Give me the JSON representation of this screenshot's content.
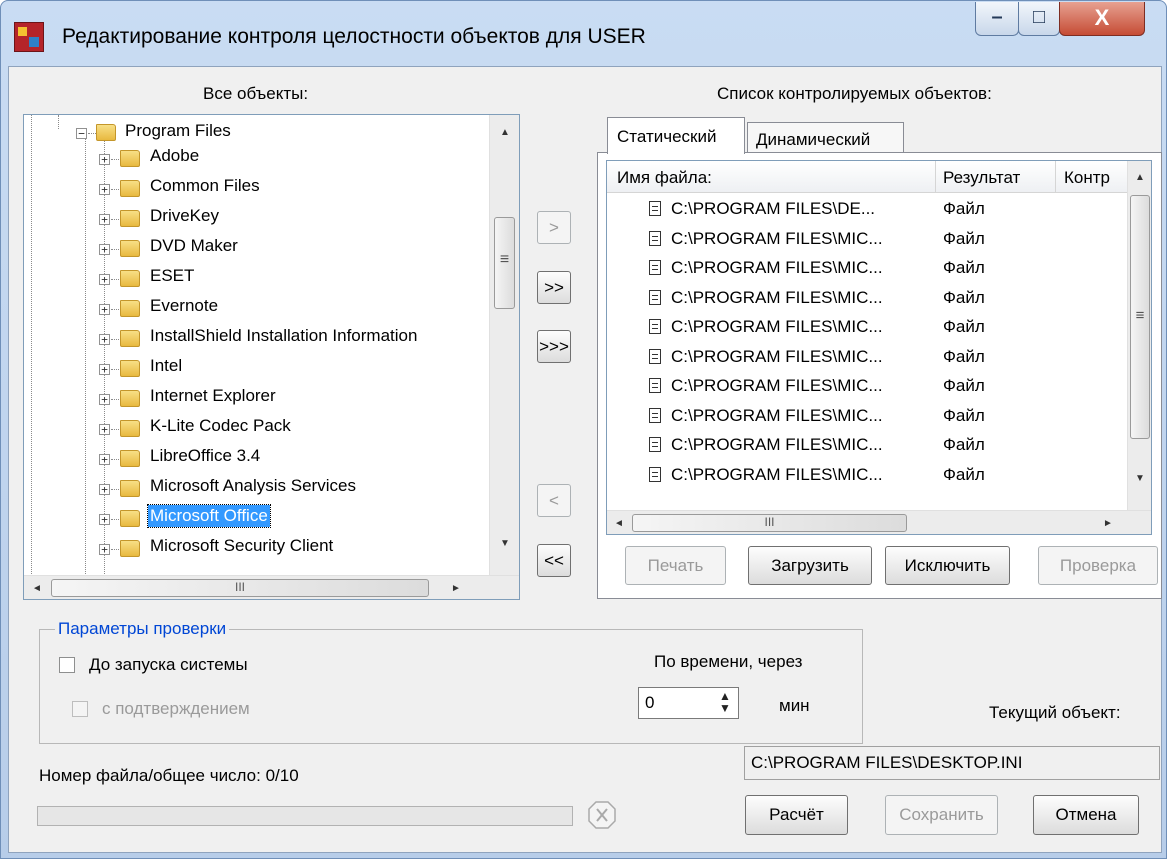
{
  "window": {
    "title": "Редактирование контроля целостности объектов для USER",
    "minimize_glyph": "–",
    "maximize_glyph": "□",
    "close_glyph": "X"
  },
  "left_panel": {
    "heading": "Все объекты:",
    "root_item": "Program Files",
    "items": [
      "Adobe",
      "Common Files",
      "DriveKey",
      "DVD Maker",
      "ESET",
      "Evernote",
      "InstallShield Installation Information",
      "Intel",
      "Internet Explorer",
      "K-Lite Codec Pack",
      "LibreOffice 3.4",
      "Microsoft Analysis Services",
      "Microsoft Office",
      "Microsoft Security Client"
    ],
    "selected_item": "Microsoft Office",
    "scroll_thumb_glyph": "≡",
    "hscroll_thumb_glyph": "III"
  },
  "transfer_buttons": {
    "add_one": ">",
    "add_many": ">>",
    "add_all": ">>>",
    "remove_one": "<",
    "remove_all": "<<"
  },
  "right_panel": {
    "heading": "Список контролируемых объектов:",
    "tabs": [
      "Статический",
      "Динамический"
    ],
    "active_tab": "Статический",
    "columns": [
      "Имя файла:",
      "Результат",
      "Контр"
    ],
    "rows": [
      {
        "name": "C:\\PROGRAM FILES\\DE...",
        "result": "Файл"
      },
      {
        "name": "C:\\PROGRAM FILES\\MIC...",
        "result": "Файл"
      },
      {
        "name": "C:\\PROGRAM FILES\\MIC...",
        "result": "Файл"
      },
      {
        "name": "C:\\PROGRAM FILES\\MIC...",
        "result": "Файл"
      },
      {
        "name": "C:\\PROGRAM FILES\\MIC...",
        "result": "Файл"
      },
      {
        "name": "C:\\PROGRAM FILES\\MIC...",
        "result": "Файл"
      },
      {
        "name": "C:\\PROGRAM FILES\\MIC...",
        "result": "Файл"
      },
      {
        "name": "C:\\PROGRAM FILES\\MIC...",
        "result": "Файл"
      },
      {
        "name": "C:\\PROGRAM FILES\\MIC...",
        "result": "Файл"
      },
      {
        "name": "C:\\PROGRAM FILES\\MIC...",
        "result": "Файл"
      }
    ],
    "buttons": {
      "print": "Печать",
      "load": "Загрузить",
      "exclude": "Исключить",
      "check": "Проверка"
    },
    "scroll_thumb_glyph": "≡",
    "hscroll_thumb_glyph": "III"
  },
  "check_params": {
    "legend": "Параметры проверки",
    "before_start_label": "До запуска системы",
    "before_start_checked": false,
    "confirm_label": "с подтверждением",
    "confirm_checked": false,
    "by_time_label": "По времени, через",
    "minutes_value": "0",
    "minutes_unit": "мин"
  },
  "current_object": {
    "label": "Текущий объект:",
    "value": "C:\\PROGRAM FILES\\DESKTOP.INI"
  },
  "progress": {
    "label": "Номер файла/общее число:",
    "value": "0/10",
    "fraction": 0
  },
  "bottom_buttons": {
    "calculate": "Расчёт",
    "save": "Сохранить",
    "cancel": "Отмена"
  },
  "icons": {
    "stop": "stop-icon",
    "up": "▲",
    "down": "▼",
    "left": "◄",
    "right": "►"
  },
  "colors": {
    "selection_bg": "#3399ff",
    "legend_blue": "#0046d5"
  }
}
